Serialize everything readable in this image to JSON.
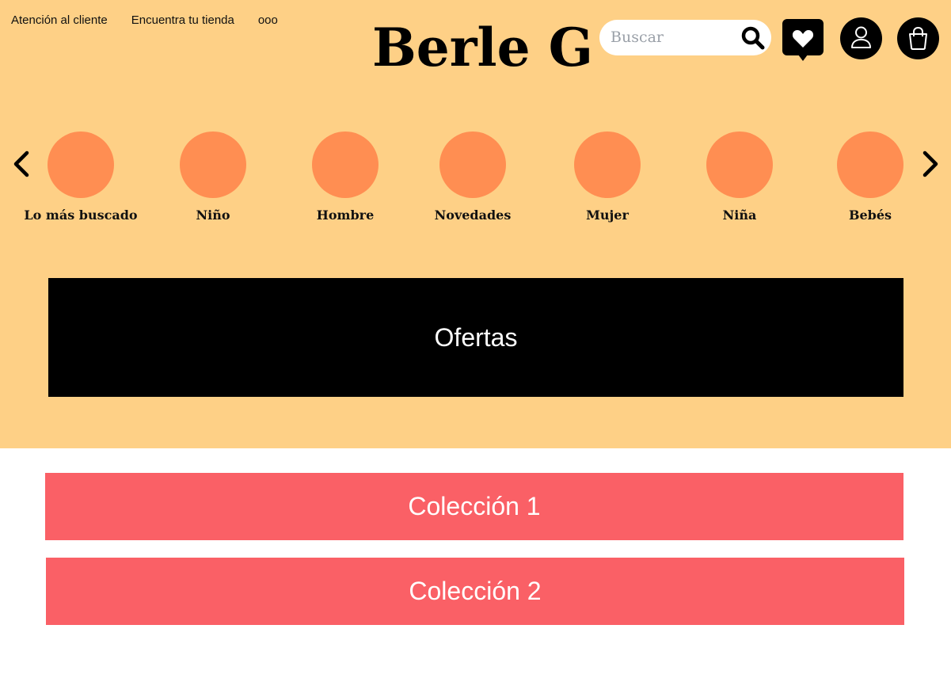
{
  "header": {
    "links": [
      "Atención al cliente",
      "Encuentra tu tienda",
      "ooo"
    ],
    "brand": "Berle G",
    "search": {
      "placeholder": "Buscar",
      "value": ""
    },
    "icons": [
      "search-icon",
      "favorites-icon",
      "user-icon",
      "bag-icon"
    ]
  },
  "categories": {
    "items": [
      {
        "label": "Lo más buscado"
      },
      {
        "label": "Niño"
      },
      {
        "label": "Hombre"
      },
      {
        "label": "Novedades"
      },
      {
        "label": "Mujer"
      },
      {
        "label": "Niña"
      },
      {
        "label": "Bebés"
      }
    ],
    "icons": [
      "chevron-left-icon",
      "chevron-right-icon"
    ]
  },
  "offers": {
    "label": "Ofertas"
  },
  "collections": [
    {
      "label": "Colección 1"
    },
    {
      "label": "Colección 2"
    }
  ],
  "colors": {
    "header_bg": "#fed086",
    "category_circle": "#ff8e52",
    "offers_bg": "#000000",
    "collection_bg": "#fa6066"
  }
}
